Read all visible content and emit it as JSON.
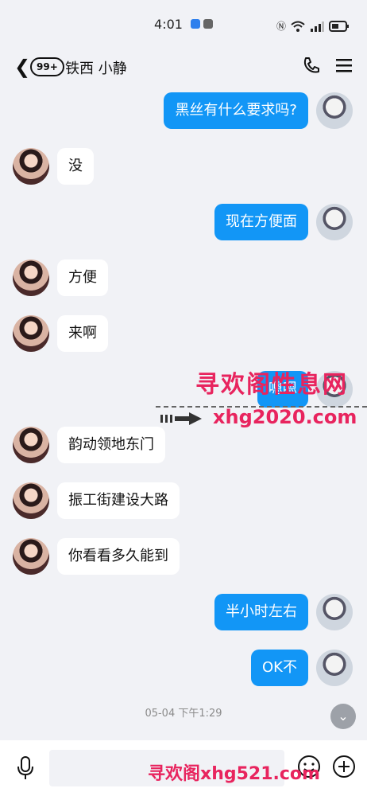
{
  "status": {
    "time": "4:01"
  },
  "header": {
    "badge": "99+",
    "contact_name": "铁西  小静"
  },
  "messages": [
    {
      "from": "me",
      "text": "黑丝有什么要求吗?"
    },
    {
      "from": "them",
      "text": "没"
    },
    {
      "from": "me",
      "text": "现在方便面"
    },
    {
      "from": "them",
      "text": "方便"
    },
    {
      "from": "them",
      "text": "来啊"
    },
    {
      "from": "me",
      "text": "嗯嗯"
    },
    {
      "from": "them",
      "text": "韵动领地东门"
    },
    {
      "from": "them",
      "text": "振工街建设大路"
    },
    {
      "from": "them",
      "text": "你看看多久能到"
    },
    {
      "from": "me",
      "text": "半小时左右"
    },
    {
      "from": "me",
      "text": "OK不"
    }
  ],
  "timestamp": "05-04 下午1:29",
  "watermarks": {
    "top_cn": "寻欢阁性息网",
    "top_url": "xhg2020.com",
    "bottom": "寻欢阁xhg521.com"
  },
  "colors": {
    "accent": "#1296f6",
    "watermark": "#e8245e",
    "background": "#f1f2f6"
  }
}
